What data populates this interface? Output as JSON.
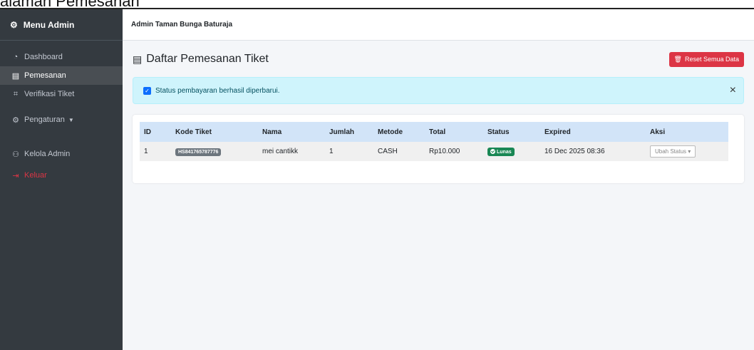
{
  "caption": "alaman Pemesanan",
  "sidebar": {
    "title": "Menu Admin",
    "title_icon": "gear-icon",
    "items": [
      {
        "label": "Dashboard",
        "icon": "dashboard-icon"
      },
      {
        "label": "Pemesanan",
        "icon": "receipt-icon"
      },
      {
        "label": "Verifikasi Tiket",
        "icon": "qr-scan-icon"
      },
      {
        "label": "Pengaturan",
        "icon": "gear-icon"
      },
      {
        "label": "Kelola Admin",
        "icon": "users-icon"
      },
      {
        "label": "Keluar",
        "icon": "logout-icon"
      }
    ]
  },
  "topbar": {
    "title": "Admin Taman Bunga Baturaja"
  },
  "page": {
    "title": "Daftar Pemesanan Tiket",
    "reset_label": "Reset Semua Data",
    "alert_text": "Status pembayaran berhasil diperbarui.",
    "alert_close": "×"
  },
  "table": {
    "headers": [
      "ID",
      "Kode Tiket",
      "Nama",
      "Jumlah",
      "Metode",
      "Total",
      "Status",
      "Expired",
      "Aksi"
    ],
    "rows": [
      {
        "id": "1",
        "kode": "HS841765787776",
        "nama": "mei cantikk",
        "jumlah": "1",
        "metode": "CASH",
        "total": "Rp10.000",
        "status": "Lunas",
        "expired": "16 Dec 2025 08:36",
        "aksi": "Ubah Status"
      }
    ]
  },
  "colors": {
    "sidebar": "#343a40",
    "danger": "#dc3545",
    "success": "#198754",
    "info_bg": "#cff4fc",
    "table_head": "#d2e4f8"
  }
}
